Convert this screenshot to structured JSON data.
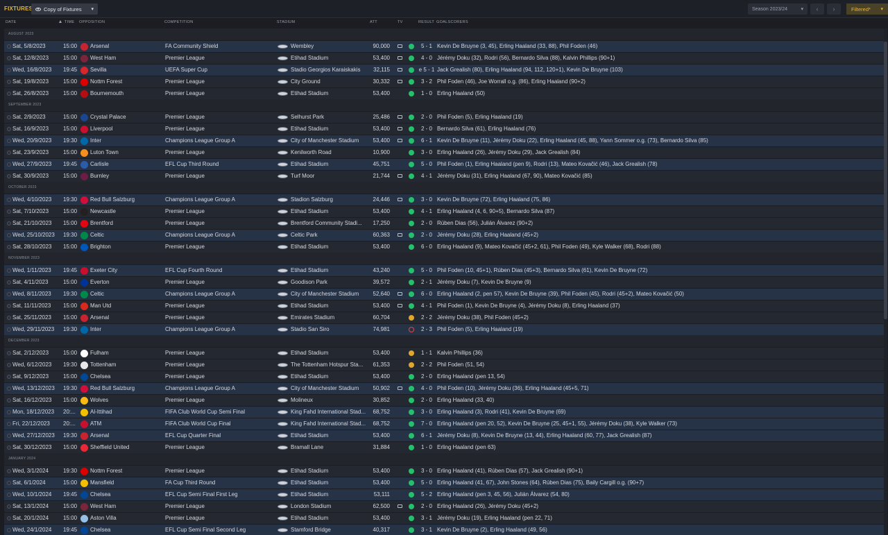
{
  "header": {
    "title": "FIXTURES",
    "view": "Copy of Fixtures",
    "season": "Season 2023/24",
    "filter": "Filtered*"
  },
  "columns": {
    "date": "DATE",
    "time": "TIME",
    "opposition": "OPPOSITION",
    "competition": "COMPETITION",
    "stadium": "STADIUM",
    "att": "ATT",
    "tv": "TV",
    "result": "RESULT",
    "goalscorers": "GOALSCORERS"
  },
  "months": [
    {
      "label": "AUGUST 2023",
      "rows": [
        {
          "date": "Sat, 5/8/2023",
          "time": "15:00",
          "opp": "Arsenal",
          "comp": "FA Community Shield",
          "stadium": "Wembley",
          "att": "90,000",
          "tv": true,
          "res": "w",
          "score": "5 - 1",
          "goals": "Kevin De Bruyne (3, 45), Erling Haaland (33, 88), Phil Foden (46)",
          "hl": true,
          "badge": "#c8242f"
        },
        {
          "date": "Sat, 12/8/2023",
          "time": "15:00",
          "opp": "West Ham",
          "comp": "Premier League",
          "stadium": "Etihad Stadium",
          "att": "53,400",
          "tv": true,
          "res": "w",
          "score": "4 - 0",
          "goals": "Jérémy Doku (32), Rodri (56), Bernardo Silva (88), Kalvin Phillips (90+1)",
          "hl": false,
          "badge": "#7a263a"
        },
        {
          "date": "Wed, 16/8/2023",
          "time": "19:45",
          "opp": "Sevilla",
          "comp": "UEFA Super Cup",
          "stadium": "Stadio Georgios Karaiskakis",
          "att": "32,115",
          "tv": true,
          "res": "w",
          "score": "e 5 - 1",
          "goals": "Jack Grealish (80), Erling Haaland (94, 112, 120+1), Kevin De Bruyne (103)",
          "hl": true,
          "badge": "#d8262b"
        },
        {
          "date": "Sat, 19/8/2023",
          "time": "15:00",
          "opp": "Nottm Forest",
          "comp": "Premier League",
          "stadium": "City Ground",
          "att": "30,332",
          "tv": true,
          "res": "w",
          "score": "3 - 2",
          "goals": "Phil Foden (46), Joe Worrall o.g. (86), Erling Haaland (90+2)",
          "hl": false,
          "badge": "#dd0000"
        },
        {
          "date": "Sat, 26/8/2023",
          "time": "15:00",
          "opp": "Bournemouth",
          "comp": "Premier League",
          "stadium": "Etihad Stadium",
          "att": "53,400",
          "tv": false,
          "res": "w",
          "score": "1 - 0",
          "goals": "Erling Haaland (50)",
          "hl": false,
          "badge": "#b50e12"
        }
      ]
    },
    {
      "label": "SEPTEMBER 2023",
      "rows": [
        {
          "date": "Sat, 2/9/2023",
          "time": "15:00",
          "opp": "Crystal Palace",
          "comp": "Premier League",
          "stadium": "Selhurst Park",
          "att": "25,486",
          "tv": true,
          "res": "w",
          "score": "2 - 0",
          "goals": "Phil Foden (5), Erling Haaland (19)",
          "hl": false,
          "badge": "#1b458f"
        },
        {
          "date": "Sat, 16/9/2023",
          "time": "15:00",
          "opp": "Liverpool",
          "comp": "Premier League",
          "stadium": "Etihad Stadium",
          "att": "53,400",
          "tv": true,
          "res": "w",
          "score": "2 - 0",
          "goals": "Bernardo Silva (61), Erling Haaland (76)",
          "hl": false,
          "badge": "#c8102e"
        },
        {
          "date": "Wed, 20/9/2023",
          "time": "19:30",
          "opp": "Inter",
          "comp": "Champions League Group A",
          "stadium": "City of Manchester Stadium",
          "att": "53,400",
          "tv": true,
          "res": "w",
          "score": "6 - 1",
          "goals": "Kevin De Bruyne (11), Jérémy Doku (22), Erling Haaland (45, 88), Yann Sommer o.g. (73), Bernardo Silva (85)",
          "hl": true,
          "badge": "#0068a8"
        },
        {
          "date": "Sat, 23/9/2023",
          "time": "15:00",
          "opp": "Luton Town",
          "comp": "Premier League",
          "stadium": "Kenilworth Road",
          "att": "10,900",
          "tv": false,
          "res": "w",
          "score": "3 - 0",
          "goals": "Erling Haaland (26), Jérémy Doku (29), Jack Grealish (84)",
          "hl": false,
          "badge": "#f78f1e"
        },
        {
          "date": "Wed, 27/9/2023",
          "time": "19:45",
          "opp": "Carlisle",
          "comp": "EFL Cup Third Round",
          "stadium": "Etihad Stadium",
          "att": "45,751",
          "tv": false,
          "res": "w",
          "score": "5 - 0",
          "goals": "Phil Foden (1), Erling Haaland (pen 9), Rodri (13), Mateo Kovačić (46), Jack Grealish (78)",
          "hl": true,
          "badge": "#2a5caa"
        },
        {
          "date": "Sat, 30/9/2023",
          "time": "15:00",
          "opp": "Burnley",
          "comp": "Premier League",
          "stadium": "Turf Moor",
          "att": "21,744",
          "tv": true,
          "res": "w",
          "score": "4 - 1",
          "goals": "Jérémy Doku (31), Erling Haaland (67, 90), Mateo Kovačić (85)",
          "hl": false,
          "badge": "#6c1d45"
        }
      ]
    },
    {
      "label": "OCTOBER 2023",
      "rows": [
        {
          "date": "Wed, 4/10/2023",
          "time": "19:30",
          "opp": "Red Bull Salzburg",
          "comp": "Champions League Group A",
          "stadium": "Stadion Salzburg",
          "att": "24,446",
          "tv": true,
          "res": "w",
          "score": "3 - 0",
          "goals": "Kevin De Bruyne (72), Erling Haaland (75, 86)",
          "hl": true,
          "badge": "#d0103a"
        },
        {
          "date": "Sat, 7/10/2023",
          "time": "15:00",
          "opp": "Newcastle",
          "comp": "Premier League",
          "stadium": "Etihad Stadium",
          "att": "53,400",
          "tv": false,
          "res": "w",
          "score": "4 - 1",
          "goals": "Erling Haaland (4, 6, 90+5), Bernardo Silva (87)",
          "hl": false,
          "badge": "#241f20"
        },
        {
          "date": "Sat, 21/10/2023",
          "time": "15:00",
          "opp": "Brentford",
          "comp": "Premier League",
          "stadium": "Brentford Community Stadi...",
          "att": "17,250",
          "tv": false,
          "res": "w",
          "score": "2 - 0",
          "goals": "Rúben Dias (56), Julián Álvarez (90+2)",
          "hl": false,
          "badge": "#e30613"
        },
        {
          "date": "Wed, 25/10/2023",
          "time": "19:30",
          "opp": "Celtic",
          "comp": "Champions League Group A",
          "stadium": "Celtic Park",
          "att": "60,363",
          "tv": true,
          "res": "w",
          "score": "2 - 0",
          "goals": "Jérémy Doku (28), Erling Haaland (45+2)",
          "hl": true,
          "badge": "#018749"
        },
        {
          "date": "Sat, 28/10/2023",
          "time": "15:00",
          "opp": "Brighton",
          "comp": "Premier League",
          "stadium": "Etihad Stadium",
          "att": "53,400",
          "tv": false,
          "res": "w",
          "score": "6 - 0",
          "goals": "Erling Haaland (9), Mateo Kovačić (45+2, 61), Phil Foden (49), Kyle Walker (68), Rodri (88)",
          "hl": false,
          "badge": "#0057b8"
        }
      ]
    },
    {
      "label": "NOVEMBER 2023",
      "rows": [
        {
          "date": "Wed, 1/11/2023",
          "time": "19:45",
          "opp": "Exeter City",
          "comp": "EFL Cup Fourth Round",
          "stadium": "Etihad Stadium",
          "att": "43,240",
          "tv": false,
          "res": "w",
          "score": "5 - 0",
          "goals": "Phil Foden (10, 45+1), Rúben Dias (45+3), Bernardo Silva (61), Kevin De Bruyne (72)",
          "hl": true,
          "badge": "#c8102e"
        },
        {
          "date": "Sat, 4/11/2023",
          "time": "15:00",
          "opp": "Everton",
          "comp": "Premier League",
          "stadium": "Goodison Park",
          "att": "39,572",
          "tv": false,
          "res": "w",
          "score": "2 - 1",
          "goals": "Jérémy Doku (7), Kevin De Bruyne (9)",
          "hl": false,
          "badge": "#003399"
        },
        {
          "date": "Wed, 8/11/2023",
          "time": "19:30",
          "opp": "Celtic",
          "comp": "Champions League Group A",
          "stadium": "City of Manchester Stadium",
          "att": "52,640",
          "tv": true,
          "res": "w",
          "score": "6 - 0",
          "goals": "Erling Haaland (2, pen 57), Kevin De Bruyne (39), Phil Foden (45), Rodri (45+2), Mateo Kovačić (50)",
          "hl": true,
          "badge": "#018749"
        },
        {
          "date": "Sat, 11/11/2023",
          "time": "15:00",
          "opp": "Man Utd",
          "comp": "Premier League",
          "stadium": "Etihad Stadium",
          "att": "53,400",
          "tv": true,
          "res": "w",
          "score": "4 - 1",
          "goals": "Phil Foden (1), Kevin De Bruyne (4), Jérémy Doku (8), Erling Haaland (37)",
          "hl": false,
          "badge": "#da291c"
        },
        {
          "date": "Sat, 25/11/2023",
          "time": "15:00",
          "opp": "Arsenal",
          "comp": "Premier League",
          "stadium": "Emirates Stadium",
          "att": "60,704",
          "tv": false,
          "res": "d",
          "score": "2 - 2",
          "goals": "Jérémy Doku (38), Phil Foden (45+2)",
          "hl": false,
          "badge": "#c8242f"
        },
        {
          "date": "Wed, 29/11/2023",
          "time": "19:30",
          "opp": "Inter",
          "comp": "Champions League Group A",
          "stadium": "Stadio San Siro",
          "att": "74,981",
          "tv": false,
          "res": "l",
          "score": "2 - 3",
          "goals": "Phil Foden (5), Erling Haaland (19)",
          "hl": true,
          "badge": "#0068a8"
        }
      ]
    },
    {
      "label": "DECEMBER 2023",
      "rows": [
        {
          "date": "Sat, 2/12/2023",
          "time": "15:00",
          "opp": "Fulham",
          "comp": "Premier League",
          "stadium": "Etihad Stadium",
          "att": "53,400",
          "tv": false,
          "res": "d",
          "score": "1 - 1",
          "goals": "Kalvin Phillips (36)",
          "hl": false,
          "badge": "#ffffff"
        },
        {
          "date": "Wed, 6/12/2023",
          "time": "19:30",
          "opp": "Tottenham",
          "comp": "Premier League",
          "stadium": "The Tottenham Hotspur Sta...",
          "att": "61,353",
          "tv": false,
          "res": "d",
          "score": "2 - 2",
          "goals": "Phil Foden (51, 54)",
          "hl": false,
          "badge": "#e8e8e8"
        },
        {
          "date": "Sat, 9/12/2023",
          "time": "15:00",
          "opp": "Chelsea",
          "comp": "Premier League",
          "stadium": "Etihad Stadium",
          "att": "53,400",
          "tv": false,
          "res": "w",
          "score": "2 - 0",
          "goals": "Erling Haaland (pen 13, 54)",
          "hl": false,
          "badge": "#034694"
        },
        {
          "date": "Wed, 13/12/2023",
          "time": "19:30",
          "opp": "Red Bull Salzburg",
          "comp": "Champions League Group A",
          "stadium": "City of Manchester Stadium",
          "att": "50,902",
          "tv": true,
          "res": "w",
          "score": "4 - 0",
          "goals": "Phil Foden (10), Jérémy Doku (36), Erling Haaland (45+5, 71)",
          "hl": true,
          "badge": "#d0103a"
        },
        {
          "date": "Sat, 16/12/2023",
          "time": "15:00",
          "opp": "Wolves",
          "comp": "Premier League",
          "stadium": "Molineux",
          "att": "30,852",
          "tv": false,
          "res": "w",
          "score": "2 - 0",
          "goals": "Erling Haaland (33, 40)",
          "hl": false,
          "badge": "#fdb913"
        },
        {
          "date": "Mon, 18/12/2023",
          "time": "20:...",
          "opp": "Al-Ittihad",
          "comp": "FIFA Club World Cup Semi Final",
          "stadium": "King Fahd International Stad...",
          "att": "68,752",
          "tv": false,
          "res": "w",
          "score": "3 - 0",
          "goals": "Erling Haaland (3), Rodri (41), Kevin De Bruyne (69)",
          "hl": true,
          "badge": "#f2c000"
        },
        {
          "date": "Fri, 22/12/2023",
          "time": "20:...",
          "opp": "ATM",
          "comp": "FIFA Club World Cup Final",
          "stadium": "King Fahd International Stad...",
          "att": "68,752",
          "tv": false,
          "res": "w",
          "score": "7 - 0",
          "goals": "Erling Haaland (pen 20, 52), Kevin De Bruyne (25, 45+1, 55), Jérémy Doku (38), Kyle Walker (73)",
          "hl": true,
          "badge": "#c8102e"
        },
        {
          "date": "Wed, 27/12/2023",
          "time": "19:30",
          "opp": "Arsenal",
          "comp": "EFL Cup Quarter Final",
          "stadium": "Etihad Stadium",
          "att": "53,400",
          "tv": false,
          "res": "w",
          "score": "6 - 1",
          "goals": "Jérémy Doku (8), Kevin De Bruyne (13, 44), Erling Haaland (60, 77), Jack Grealish (87)",
          "hl": true,
          "badge": "#c8242f"
        },
        {
          "date": "Sat, 30/12/2023",
          "time": "15:00",
          "opp": "Sheffield United",
          "comp": "Premier League",
          "stadium": "Bramall Lane",
          "att": "31,884",
          "tv": false,
          "res": "w",
          "score": "1 - 0",
          "goals": "Erling Haaland (pen 63)",
          "hl": false,
          "badge": "#ee2737"
        }
      ]
    },
    {
      "label": "JANUARY 2024",
      "rows": [
        {
          "date": "Wed, 3/1/2024",
          "time": "19:30",
          "opp": "Nottm Forest",
          "comp": "Premier League",
          "stadium": "Etihad Stadium",
          "att": "53,400",
          "tv": false,
          "res": "w",
          "score": "3 - 0",
          "goals": "Erling Haaland (41), Rúben Dias (57), Jack Grealish (90+1)",
          "hl": false,
          "badge": "#dd0000"
        },
        {
          "date": "Sat, 6/1/2024",
          "time": "15:00",
          "opp": "Mansfield",
          "comp": "FA Cup Third Round",
          "stadium": "Etihad Stadium",
          "att": "53,400",
          "tv": false,
          "res": "w",
          "score": "5 - 0",
          "goals": "Erling Haaland (41, 67), John Stones (64), Rúben Dias (75), Baily Cargill o.g. (90+7)",
          "hl": true,
          "badge": "#f2c000"
        },
        {
          "date": "Wed, 10/1/2024",
          "time": "19:45",
          "opp": "Chelsea",
          "comp": "EFL Cup Semi Final First Leg",
          "stadium": "Etihad Stadium",
          "att": "53,111",
          "tv": false,
          "res": "w",
          "score": "5 - 2",
          "goals": "Erling Haaland (pen 3, 45, 56), Julián Álvarez (54, 80)",
          "hl": true,
          "badge": "#034694"
        },
        {
          "date": "Sat, 13/1/2024",
          "time": "15:00",
          "opp": "West Ham",
          "comp": "Premier League",
          "stadium": "London Stadium",
          "att": "62,500",
          "tv": true,
          "res": "w",
          "score": "2 - 0",
          "goals": "Erling Haaland (26), Jérémy Doku (45+2)",
          "hl": false,
          "badge": "#7a263a"
        },
        {
          "date": "Sat, 20/1/2024",
          "time": "15:00",
          "opp": "Aston Villa",
          "comp": "Premier League",
          "stadium": "Etihad Stadium",
          "att": "53,400",
          "tv": false,
          "res": "w",
          "score": "3 - 1",
          "goals": "Jérémy Doku (19), Erling Haaland (pen 22, 71)",
          "hl": false,
          "badge": "#95bfe5"
        },
        {
          "date": "Wed, 24/1/2024",
          "time": "19:45",
          "opp": "Chelsea",
          "comp": "EFL Cup Semi Final Second Leg",
          "stadium": "Stamford Bridge",
          "att": "40,317",
          "tv": false,
          "res": "w",
          "score": "3 - 1",
          "goals": "Kevin De Bruyne (2), Erling Haaland (49, 56)",
          "hl": true,
          "badge": "#034694"
        }
      ]
    }
  ]
}
